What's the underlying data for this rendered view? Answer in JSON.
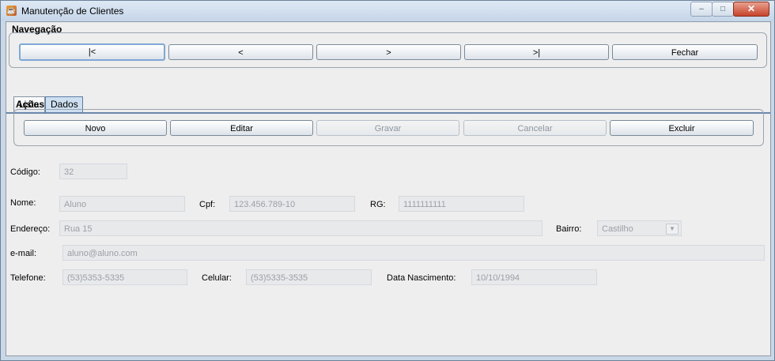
{
  "window": {
    "title": "Manutenção de Clientes",
    "minimize": "–",
    "maximize": "□",
    "close": "✕"
  },
  "navegacao": {
    "legend": "Navegação",
    "buttons": [
      {
        "label": "|<"
      },
      {
        "label": "<"
      },
      {
        "label": ">"
      },
      {
        "label": ">|"
      },
      {
        "label": "Fechar"
      }
    ]
  },
  "tabs": [
    {
      "label": "Lista"
    },
    {
      "label": "Dados"
    }
  ],
  "acoes": {
    "legend": "Ações",
    "buttons": [
      {
        "label": "Novo"
      },
      {
        "label": "Editar"
      },
      {
        "label": "Gravar"
      },
      {
        "label": "Cancelar"
      },
      {
        "label": "Excluir"
      }
    ]
  },
  "form": {
    "codigo": {
      "label": "Código:",
      "value": "32"
    },
    "nome": {
      "label": "Nome:",
      "value": "Aluno"
    },
    "cpf": {
      "label": "Cpf:",
      "value": "123.456.789-10"
    },
    "rg": {
      "label": "RG:",
      "value": "1111111111"
    },
    "endereco": {
      "label": "Endereço:",
      "value": "Rua 15"
    },
    "bairro": {
      "label": "Bairro:",
      "value": "Castilho"
    },
    "email": {
      "label": "e-mail:",
      "value": "aluno@aluno.com"
    },
    "telefone": {
      "label": "Telefone:",
      "value": "(53)5353-5335"
    },
    "celular": {
      "label": "Celular:",
      "value": "(53)5335-3535"
    },
    "nascimento": {
      "label": "Data Nascimento:",
      "value": "10/10/1994"
    }
  }
}
